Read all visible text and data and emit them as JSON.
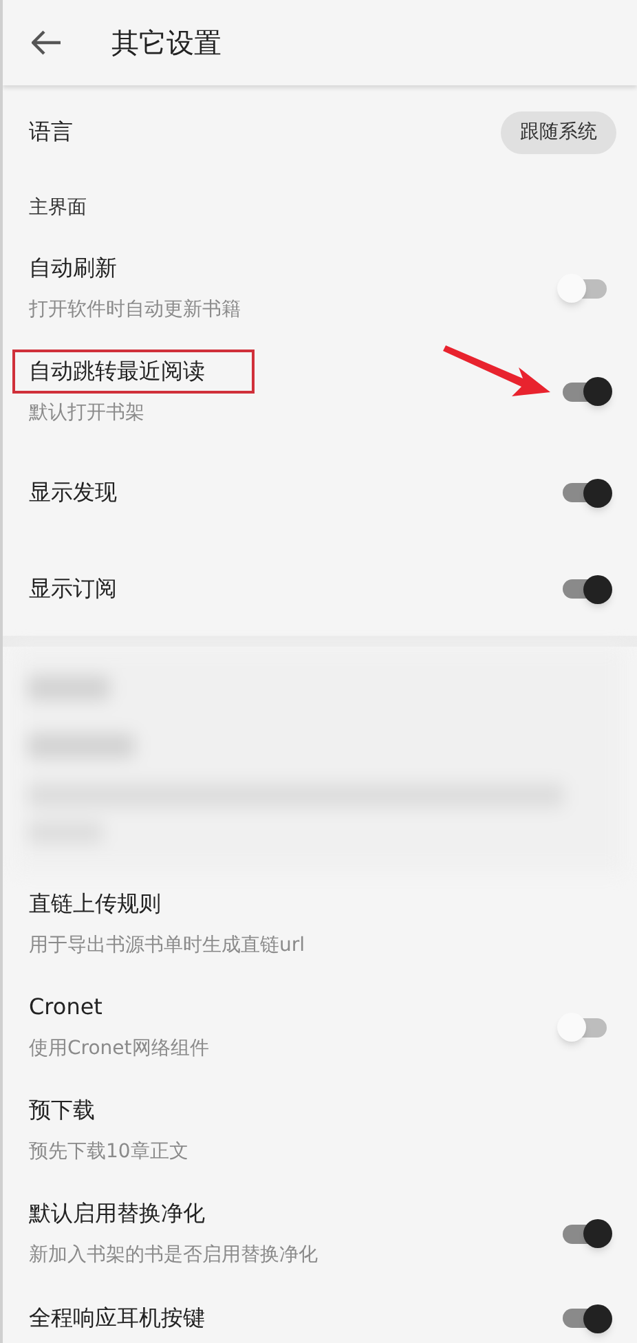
{
  "header": {
    "title": "其它设置"
  },
  "language": {
    "label": "语言",
    "value": "跟随系统"
  },
  "sections": [
    {
      "title": "主界面",
      "items": [
        {
          "kind": "switch",
          "title": "自动刷新",
          "subtitle": "打开软件时自动更新书籍",
          "on": false,
          "highlighted": false,
          "arrow": false
        },
        {
          "kind": "switch",
          "title": "自动跳转最近阅读",
          "subtitle": "默认打开书架",
          "on": true,
          "highlighted": true,
          "arrow": true
        },
        {
          "kind": "switch",
          "title": "显示发现",
          "on": true,
          "highlighted": false,
          "arrow": false
        },
        {
          "kind": "switch",
          "title": "显示订阅",
          "on": true,
          "highlighted": false,
          "arrow": false
        }
      ]
    },
    {
      "blurred": true,
      "items": [
        {
          "kind": "plain",
          "title": "直链上传规则",
          "subtitle": "用于导出书源书单时生成直链url",
          "highlighted": false,
          "arrow": false
        },
        {
          "kind": "switch",
          "title": "Cronet",
          "subtitle": "使用Cronet网络组件",
          "on": false,
          "highlighted": false,
          "arrow": false
        },
        {
          "kind": "plain",
          "title": "预下载",
          "subtitle": "预先下载10章正文",
          "highlighted": false,
          "arrow": false
        },
        {
          "kind": "switch",
          "title": "默认启用替换净化",
          "subtitle": "新加入书架的书是否启用替换净化",
          "on": true,
          "highlighted": false,
          "arrow": false
        },
        {
          "kind": "switch",
          "title": "全程响应耳机按键",
          "on": true,
          "highlighted": false,
          "arrow": false
        }
      ]
    }
  ]
}
